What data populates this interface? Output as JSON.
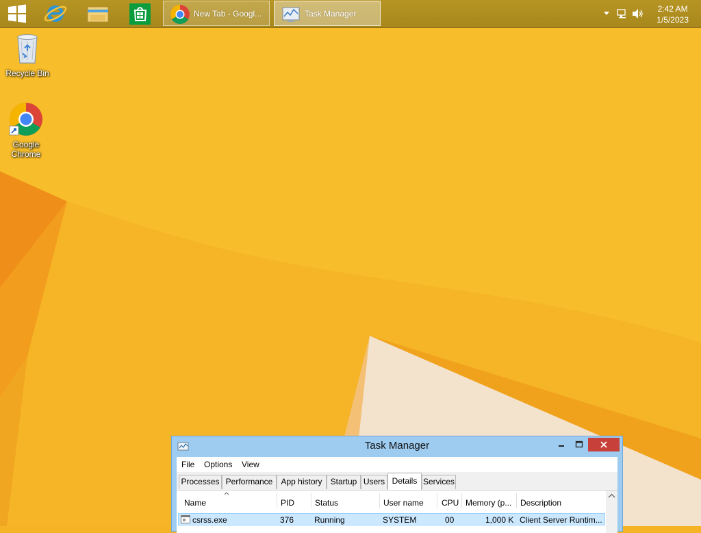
{
  "taskbar": {
    "tasks": [
      {
        "label": "New Tab - Googl..."
      },
      {
        "label": "Task Manager"
      }
    ],
    "clock": {
      "time": "2:42 AM",
      "date": "1/5/2023"
    }
  },
  "desktop": {
    "icons": [
      {
        "label": "Recycle Bin"
      },
      {
        "label": "Google Chrome"
      }
    ]
  },
  "task_manager": {
    "title": "Task Manager",
    "menu": [
      "File",
      "Options",
      "View"
    ],
    "tabs": [
      "Processes",
      "Performance",
      "App history",
      "Startup",
      "Users",
      "Details",
      "Services"
    ],
    "selected_tab": "Details",
    "columns": [
      "Name",
      "PID",
      "Status",
      "User name",
      "CPU",
      "Memory (p...",
      "Description"
    ],
    "rows": [
      {
        "name": "csrss.exe",
        "pid": "376",
        "status": "Running",
        "user": "SYSTEM",
        "cpu": "00",
        "memory": "1,000 K",
        "description": "Client Server Runtim..."
      }
    ]
  },
  "colors": {
    "wallpaper": "#f5b325",
    "taskbar": "#b08f20",
    "accent_blue": "#9ecbf0",
    "close_red": "#c7403a",
    "selection": "#cce8ff"
  }
}
